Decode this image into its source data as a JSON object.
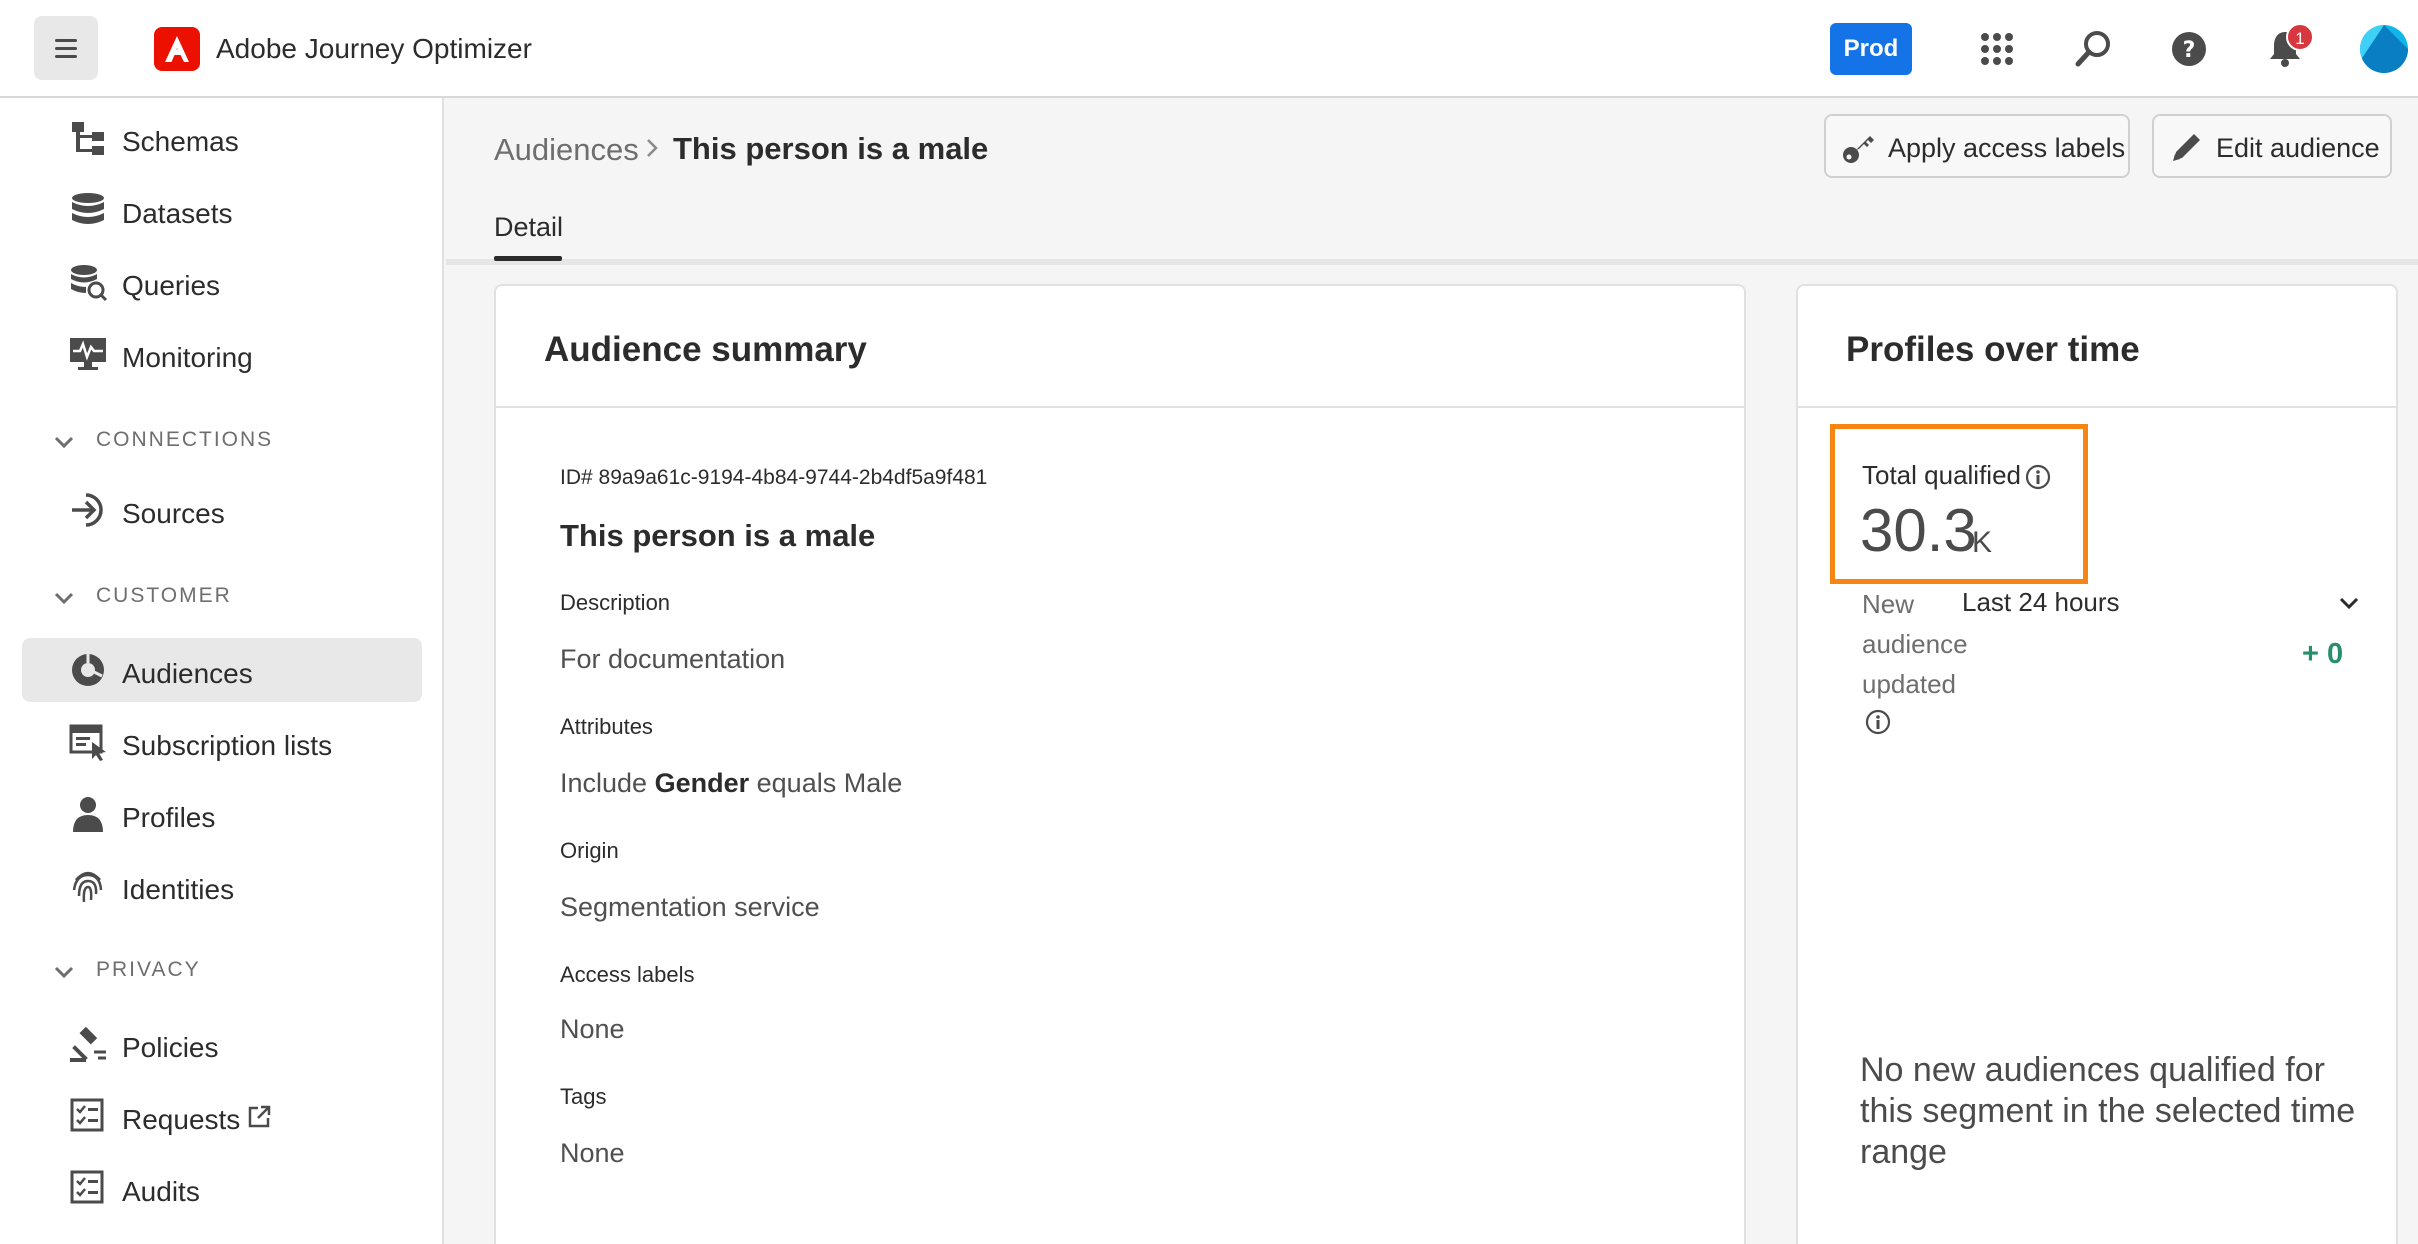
{
  "app": {
    "title": "Adobe Journey Optimizer",
    "environment": "Prod",
    "notification_count": "1",
    "icons": [
      "menu-icon",
      "adobe-logo",
      "apps-grid-icon",
      "search-icon",
      "help-icon",
      "bell-icon",
      "avatar"
    ]
  },
  "sidebar": {
    "items": [
      {
        "label": "Schemas",
        "icon": "schema-icon"
      },
      {
        "label": "Datasets",
        "icon": "database-icon"
      },
      {
        "label": "Queries",
        "icon": "query-icon"
      },
      {
        "label": "Monitoring",
        "icon": "monitoring-icon"
      },
      {
        "label": "Sources",
        "icon": "sources-icon"
      },
      {
        "label": "Audiences",
        "icon": "audiences-icon",
        "active": true
      },
      {
        "label": "Subscription lists",
        "icon": "subscription-icon"
      },
      {
        "label": "Profiles",
        "icon": "profile-icon"
      },
      {
        "label": "Identities",
        "icon": "fingerprint-icon"
      },
      {
        "label": "Policies",
        "icon": "gavel-icon"
      },
      {
        "label": "Requests",
        "icon": "checklist-icon"
      },
      {
        "label": "Audits",
        "icon": "checklist-icon"
      }
    ],
    "sections": {
      "connections": "CONNECTIONS",
      "customer": "CUSTOMER",
      "privacy": "PRIVACY"
    }
  },
  "breadcrumb": {
    "root": "Audiences",
    "current": "This person is a male"
  },
  "actions": {
    "apply_access_labels": "Apply access labels",
    "edit_audience": "Edit audience"
  },
  "tabs": {
    "detail": "Detail"
  },
  "summary": {
    "title": "Audience summary",
    "id": "ID# 89a9a61c-9194-4b84-9744-2b4df5a9f481",
    "name": "This person is a male",
    "description_label": "Description",
    "description": "For documentation",
    "attributes_label": "Attributes",
    "attributes_prefix": "Include",
    "attributes_field": "Gender",
    "attributes_suffix": "equals Male",
    "origin_label": "Origin",
    "origin": "Segmentation service",
    "access_labels_label": "Access labels",
    "access_labels": "None",
    "tags_label": "Tags",
    "tags": "None"
  },
  "profiles": {
    "title": "Profiles over time",
    "total_label": "Total qualified",
    "total_value": "30.3",
    "total_unit": "K",
    "new_label_1": "New",
    "new_label_2": "audience",
    "new_label_3": "updated",
    "range": "Last 24 hours",
    "delta": "+ 0",
    "empty_message": "No new audiences qualified for this segment in the selected time range",
    "highlight_color": "#f68511",
    "delta_color": "#268e6c"
  }
}
